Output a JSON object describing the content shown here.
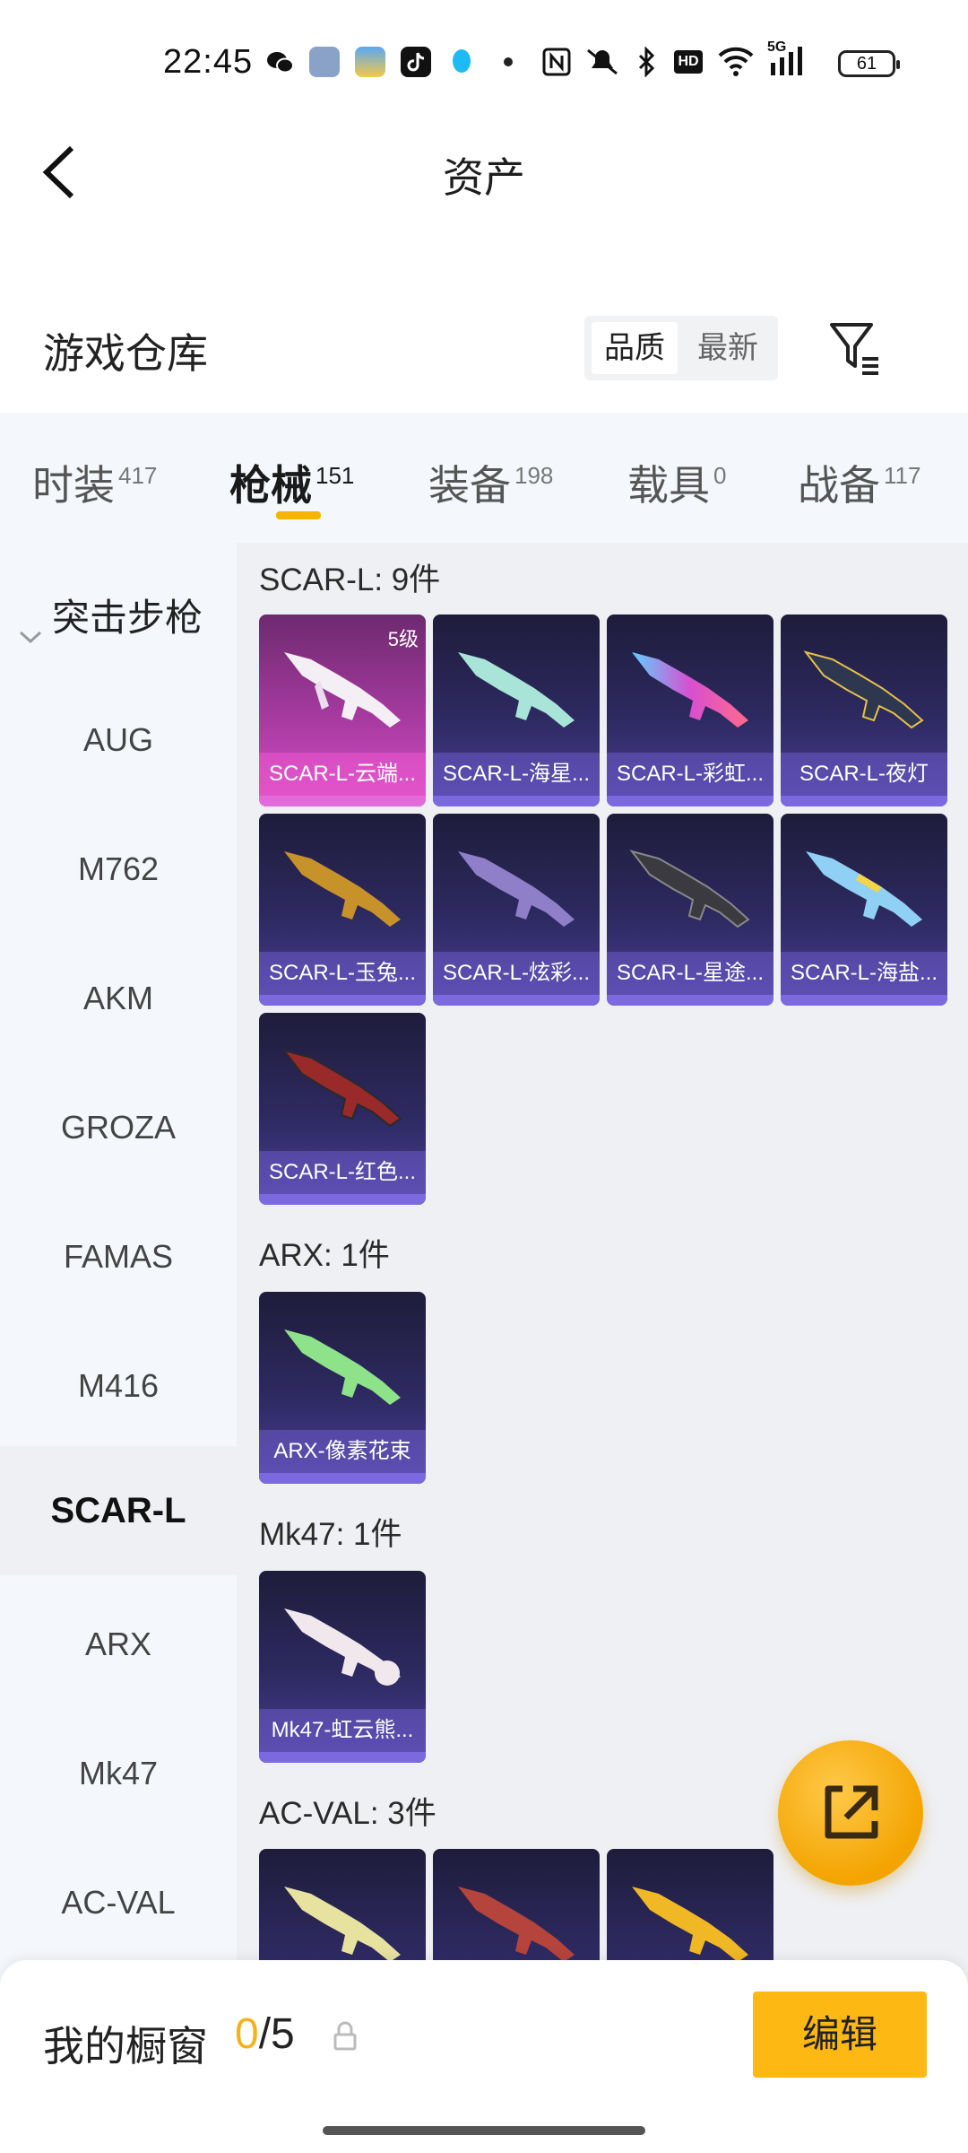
{
  "status_bar": {
    "time": "22:45",
    "network": "5G",
    "battery": "61",
    "icons": [
      "wechat-icon",
      "cat-app-icon",
      "weather-icon",
      "tiktok-icon",
      "qq-icon",
      "dot-icon",
      "nfc-icon",
      "mute-icon",
      "bluetooth-icon",
      "hd-icon",
      "wifi-icon",
      "signal-icon",
      "battery-icon"
    ]
  },
  "header": {
    "title": "资产"
  },
  "warehouse": {
    "title": "游戏仓库",
    "sort_options": [
      "品质",
      "最新"
    ],
    "sort_selected": "品质"
  },
  "tabs": [
    {
      "label": "时装",
      "count": "417"
    },
    {
      "label": "枪械",
      "count": "151"
    },
    {
      "label": "装备",
      "count": "198"
    },
    {
      "label": "载具",
      "count": "0"
    },
    {
      "label": "战备",
      "count": "117"
    }
  ],
  "sidebar": {
    "category": "突击步枪",
    "items": [
      "AUG",
      "M762",
      "AKM",
      "GROZA",
      "FAMAS",
      "M416",
      "SCAR-L",
      "ARX",
      "Mk47",
      "AC-VAL"
    ],
    "selected": "SCAR-L"
  },
  "groups": [
    {
      "title": "SCAR-L: 9件",
      "items": [
        {
          "name": "SCAR-L-云端...",
          "grade": "5级"
        },
        {
          "name": "SCAR-L-海星..."
        },
        {
          "name": "SCAR-L-彩虹..."
        },
        {
          "name": "SCAR-L-夜灯"
        },
        {
          "name": "SCAR-L-玉兔..."
        },
        {
          "name": "SCAR-L-炫彩..."
        },
        {
          "name": "SCAR-L-星途..."
        },
        {
          "name": "SCAR-L-海盐..."
        },
        {
          "name": "SCAR-L-红色..."
        }
      ]
    },
    {
      "title": "ARX: 1件",
      "items": [
        {
          "name": "ARX-像素花束"
        }
      ]
    },
    {
      "title": "Mk47: 1件",
      "items": [
        {
          "name": "Mk47-虹云熊..."
        }
      ]
    },
    {
      "title": "AC-VAL: 3件",
      "items": [
        {
          "name": ""
        },
        {
          "name": ""
        },
        {
          "name": ""
        }
      ]
    }
  ],
  "bottom_bar": {
    "label": "我的橱窗",
    "count_current": "0",
    "count_separator": "/",
    "count_total": "5",
    "edit_label": "编辑"
  },
  "colors": {
    "accent": "#fdb813",
    "card_dark": "#2e2a62",
    "card_pink": "#a83aa1",
    "sidebar_bg": "#f4f8fc",
    "content_bg": "#eff0f3"
  }
}
